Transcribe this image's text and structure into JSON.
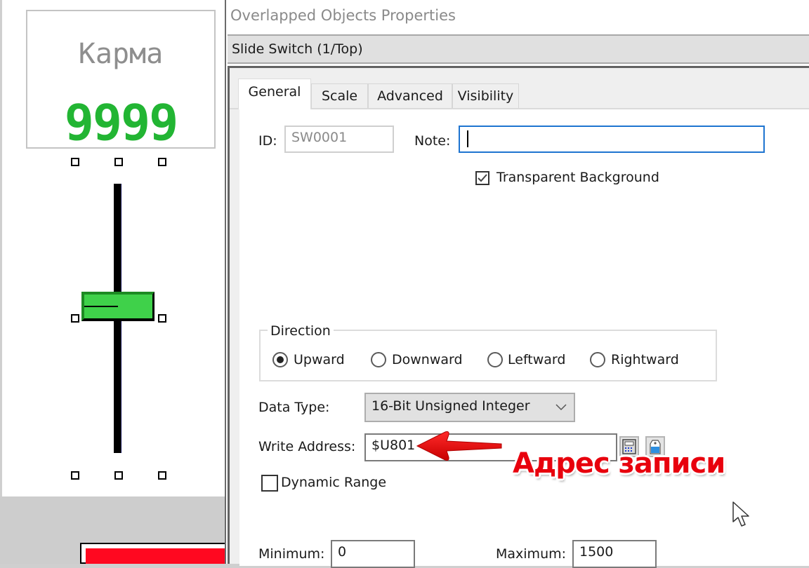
{
  "canvas": {
    "karma_label": "Карма",
    "karma_value": "9999",
    "slider_position_fraction": 0.55
  },
  "dialog": {
    "title": "Overlapped Objects Properties",
    "object_header": "Slide Switch (1/Top)",
    "tabs": [
      {
        "label": "General",
        "active": true
      },
      {
        "label": "Scale",
        "active": false
      },
      {
        "label": "Advanced",
        "active": false
      },
      {
        "label": "Visibility",
        "active": false
      }
    ],
    "general": {
      "id_label": "ID:",
      "id_value": "SW0001",
      "note_label": "Note:",
      "note_value": "",
      "transparent_bg_label": "Transparent Background",
      "transparent_bg_checked": true,
      "direction": {
        "title": "Direction",
        "options": [
          {
            "label": "Upward",
            "selected": true
          },
          {
            "label": "Downward",
            "selected": false
          },
          {
            "label": "Leftward",
            "selected": false
          },
          {
            "label": "Rightward",
            "selected": false
          }
        ]
      },
      "data_type_label": "Data Type:",
      "data_type_value": "16-Bit Unsigned Integer",
      "write_address_label": "Write Address:",
      "write_address_value": "$U801",
      "keypad_icon": "keypad-icon",
      "tag_icon": "tag-icon",
      "dynamic_range_label": "Dynamic Range",
      "dynamic_range_checked": false,
      "minimum_label": "Minimum:",
      "minimum_value": "0",
      "maximum_label": "Maximum:",
      "maximum_value": "1500"
    }
  },
  "annotation": {
    "text": "Адрес записи",
    "color": "#e8000d"
  }
}
